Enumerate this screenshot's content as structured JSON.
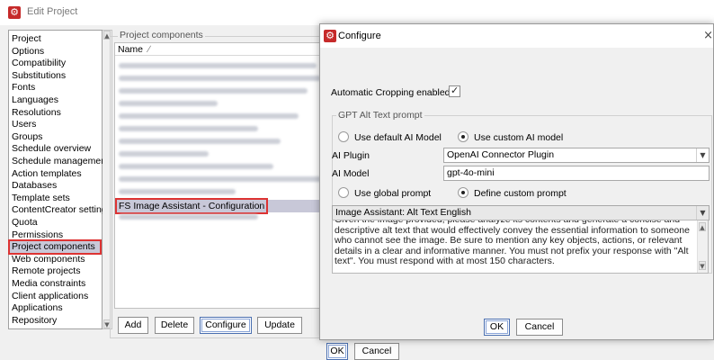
{
  "back_window": {
    "title": "Edit Project",
    "categories": [
      "Project",
      "Options",
      "Compatibility",
      "Substitutions",
      "Fonts",
      "Languages",
      "Resolutions",
      "Users",
      "Groups",
      "Schedule overview",
      "Schedule management",
      "Action templates",
      "Databases",
      "Template sets",
      "ContentCreator settings",
      "Quota",
      "Permissions",
      "Project components",
      "Web components",
      "Remote projects",
      "Media constraints",
      "Client applications",
      "Applications",
      "Repository"
    ],
    "selected_category": "Project components",
    "components_legend": "Project components",
    "components_header": "Name",
    "sort_indicator": "∕",
    "selected_component": "FS Image Assistant - Configuration",
    "buttons": {
      "add": "Add",
      "delete": "Delete",
      "configure": "Configure",
      "update": "Update"
    },
    "footer": {
      "ok": "OK",
      "cancel": "Cancel"
    }
  },
  "dialog": {
    "title": "Configure",
    "close_glyph": "×",
    "auto_cropping_label": "Automatic Cropping enabled",
    "auto_cropping_checked": true,
    "gpt_group_legend": "GPT Alt Text prompt",
    "model_options": {
      "default": "Use default AI Model",
      "custom": "Use custom AI model",
      "selected": "custom"
    },
    "ai_plugin_label": "AI Plugin",
    "ai_plugin_value": "OpenAI Connector Plugin",
    "ai_model_label": "AI Model",
    "ai_model_value": "gpt-4o-mini",
    "prompt_options": {
      "global": "Use global prompt",
      "custom": "Define custom prompt",
      "selected": "custom"
    },
    "prompt_template": "Image Assistant: Alt Text English",
    "prompt_text": "Given the image provided, please analyze its contents and generate a concise and descriptive alt text that would effectively convey the essential information to someone who cannot see the image. Be sure to mention any key objects, actions, or relevant details in a clear and informative manner. You must not prefix your response with \"Alt text\". You must respond with at most 150 characters.",
    "ok_label": "OK",
    "cancel_label": "Cancel"
  },
  "icons": {
    "app": "gear-icon",
    "dropdown": "chevron-down-icon",
    "scroll_up": "arrow-up-icon",
    "scroll_down": "arrow-down-icon"
  },
  "colors": {
    "brand": "#c62a2a",
    "highlight_outline": "#dd3333",
    "selection": "#c8c8d8"
  }
}
